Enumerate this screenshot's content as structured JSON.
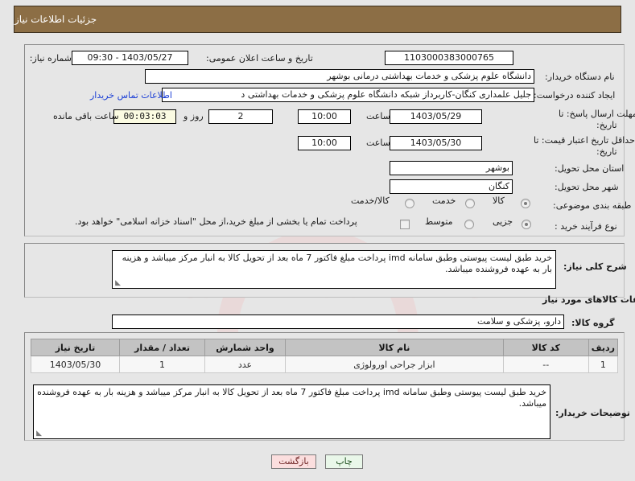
{
  "header": {
    "title": "جزئیات اطلاعات نیاز"
  },
  "main": {
    "need_number": {
      "label": "شماره نیاز:",
      "value": "1103000383000765"
    },
    "announce": {
      "label": "تاریخ و ساعت اعلان عمومی:",
      "value": "1403/05/27 - 09:30"
    },
    "buyer_org": {
      "label": "نام دستگاه خریدار:",
      "value": "دانشگاه علوم پزشکی و خدمات بهداشتی درمانی بوشهر"
    },
    "creator": {
      "label": "ایجاد کننده درخواست:",
      "value": "جلیل علمداری کنگان-کاربرداز شبکه دانشگاه علوم پزشکی و خدمات بهداشتی د",
      "contact_link": "اطلاعات تماس خریدار"
    },
    "reply_deadline": {
      "label_line1": "مهلت ارسال پاسخ: تا",
      "label_line2": "تاریخ:",
      "date": "1403/05/29",
      "hour_label": "ساعت",
      "hour": "10:00",
      "days": "2",
      "days_suffix": "روز و",
      "timer": "00:03:03",
      "timer_suffix": "ساعت باقی مانده"
    },
    "price_validity": {
      "label_line1": "حداقل تاریخ اعتبار قیمت: تا",
      "label_line2": "تاریخ:",
      "date": "1403/05/30",
      "hour_label": "ساعت",
      "hour": "10:00"
    },
    "province": {
      "label": "استان محل تحویل:",
      "value": "بوشهر"
    },
    "city": {
      "label": "شهر محل تحویل:",
      "value": "کنگان"
    },
    "subject_class": {
      "label": "طبقه بندی موضوعی:",
      "options": [
        "کالا",
        "خدمت",
        "کالا/خدمت"
      ],
      "selected": 0
    },
    "purchase_process": {
      "label": "نوع فرآیند خرید :",
      "options": [
        "جزیی",
        "متوسط"
      ],
      "selected": 0,
      "checkbox_label": "پرداخت تمام یا بخشی از مبلغ خرید،از محل \"اسناد خزانه اسلامی\" خواهد بود.",
      "checkbox_checked": false
    }
  },
  "description": {
    "label": "شرح کلی نیاز:",
    "value": "خرید طبق لیست پیوستی وطبق سامانه  imd پرداخت مبلغ فاکتور 7 ماه بعد از تحویل کالا به انبار مرکز میباشد و هزینه بار به عهده فروشنده میباشد."
  },
  "goods_section": {
    "heading": "اطلاعات کالاهای مورد نیاز",
    "group": {
      "label": "گروه کالا:",
      "value": "دارو، پزشکی و سلامت"
    },
    "table": {
      "columns": [
        "ردیف",
        "کد کالا",
        "نام کالا",
        "واحد شمارش",
        "تعداد / مقدار",
        "تاریخ نیاز"
      ],
      "rows": [
        [
          "1",
          "--",
          "ابزار جراحی اورولوژی",
          "عدد",
          "1",
          "1403/05/30"
        ]
      ]
    }
  },
  "buyer_notes": {
    "label": "توضیحات خریدار:",
    "value": "خرید طبق لیست پیوستی وطبق سامانه  imd پرداخت مبلغ فاکتور 7 ماه بعد از تحویل کالا به انبار مرکز میباشد و هزینه بار به عهده فروشنده میباشد."
  },
  "footer": {
    "print_label": "چاپ",
    "back_label": "بازگشت"
  },
  "watermark": {
    "text": "rtalemdar.net"
  }
}
